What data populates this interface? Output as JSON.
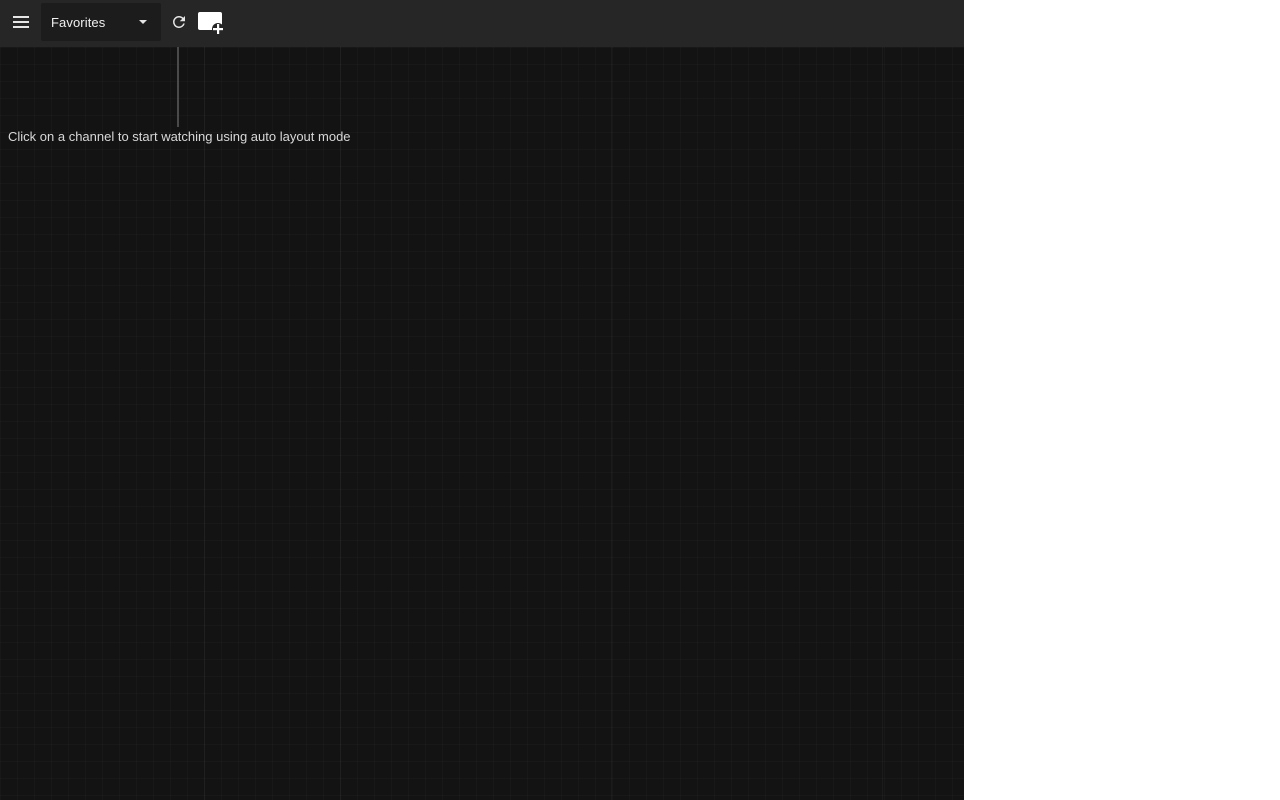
{
  "toolbar": {
    "menu_icon": "menu-icon",
    "list_select": {
      "selected": "Favorites",
      "caret_icon": "caret-down-icon"
    },
    "refresh_icon": "refresh-icon",
    "add_stream_icon": "add-stream-icon"
  },
  "main": {
    "hint": "Click on a channel to start watching using auto layout mode"
  },
  "colors": {
    "toolbar_bg": "#262626",
    "select_bg": "#1c1c1c",
    "canvas_bg": "#131313",
    "text": "#d8d8d8"
  }
}
